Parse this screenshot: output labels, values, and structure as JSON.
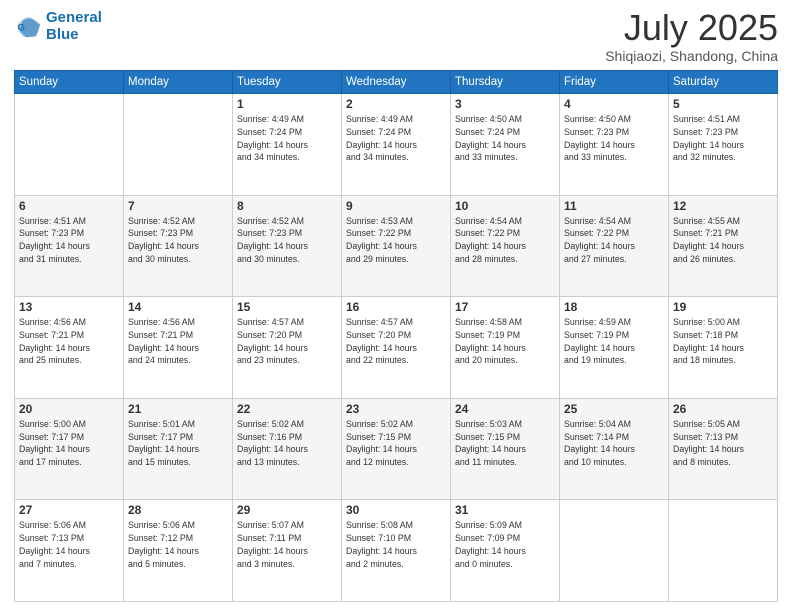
{
  "logo": {
    "line1": "General",
    "line2": "Blue"
  },
  "title": "July 2025",
  "location": "Shiqiaozi, Shandong, China",
  "days_of_week": [
    "Sunday",
    "Monday",
    "Tuesday",
    "Wednesday",
    "Thursday",
    "Friday",
    "Saturday"
  ],
  "weeks": [
    [
      {
        "day": "",
        "info": ""
      },
      {
        "day": "",
        "info": ""
      },
      {
        "day": "1",
        "info": "Sunrise: 4:49 AM\nSunset: 7:24 PM\nDaylight: 14 hours\nand 34 minutes."
      },
      {
        "day": "2",
        "info": "Sunrise: 4:49 AM\nSunset: 7:24 PM\nDaylight: 14 hours\nand 34 minutes."
      },
      {
        "day": "3",
        "info": "Sunrise: 4:50 AM\nSunset: 7:24 PM\nDaylight: 14 hours\nand 33 minutes."
      },
      {
        "day": "4",
        "info": "Sunrise: 4:50 AM\nSunset: 7:23 PM\nDaylight: 14 hours\nand 33 minutes."
      },
      {
        "day": "5",
        "info": "Sunrise: 4:51 AM\nSunset: 7:23 PM\nDaylight: 14 hours\nand 32 minutes."
      }
    ],
    [
      {
        "day": "6",
        "info": "Sunrise: 4:51 AM\nSunset: 7:23 PM\nDaylight: 14 hours\nand 31 minutes."
      },
      {
        "day": "7",
        "info": "Sunrise: 4:52 AM\nSunset: 7:23 PM\nDaylight: 14 hours\nand 30 minutes."
      },
      {
        "day": "8",
        "info": "Sunrise: 4:52 AM\nSunset: 7:23 PM\nDaylight: 14 hours\nand 30 minutes."
      },
      {
        "day": "9",
        "info": "Sunrise: 4:53 AM\nSunset: 7:22 PM\nDaylight: 14 hours\nand 29 minutes."
      },
      {
        "day": "10",
        "info": "Sunrise: 4:54 AM\nSunset: 7:22 PM\nDaylight: 14 hours\nand 28 minutes."
      },
      {
        "day": "11",
        "info": "Sunrise: 4:54 AM\nSunset: 7:22 PM\nDaylight: 14 hours\nand 27 minutes."
      },
      {
        "day": "12",
        "info": "Sunrise: 4:55 AM\nSunset: 7:21 PM\nDaylight: 14 hours\nand 26 minutes."
      }
    ],
    [
      {
        "day": "13",
        "info": "Sunrise: 4:56 AM\nSunset: 7:21 PM\nDaylight: 14 hours\nand 25 minutes."
      },
      {
        "day": "14",
        "info": "Sunrise: 4:56 AM\nSunset: 7:21 PM\nDaylight: 14 hours\nand 24 minutes."
      },
      {
        "day": "15",
        "info": "Sunrise: 4:57 AM\nSunset: 7:20 PM\nDaylight: 14 hours\nand 23 minutes."
      },
      {
        "day": "16",
        "info": "Sunrise: 4:57 AM\nSunset: 7:20 PM\nDaylight: 14 hours\nand 22 minutes."
      },
      {
        "day": "17",
        "info": "Sunrise: 4:58 AM\nSunset: 7:19 PM\nDaylight: 14 hours\nand 20 minutes."
      },
      {
        "day": "18",
        "info": "Sunrise: 4:59 AM\nSunset: 7:19 PM\nDaylight: 14 hours\nand 19 minutes."
      },
      {
        "day": "19",
        "info": "Sunrise: 5:00 AM\nSunset: 7:18 PM\nDaylight: 14 hours\nand 18 minutes."
      }
    ],
    [
      {
        "day": "20",
        "info": "Sunrise: 5:00 AM\nSunset: 7:17 PM\nDaylight: 14 hours\nand 17 minutes."
      },
      {
        "day": "21",
        "info": "Sunrise: 5:01 AM\nSunset: 7:17 PM\nDaylight: 14 hours\nand 15 minutes."
      },
      {
        "day": "22",
        "info": "Sunrise: 5:02 AM\nSunset: 7:16 PM\nDaylight: 14 hours\nand 13 minutes."
      },
      {
        "day": "23",
        "info": "Sunrise: 5:02 AM\nSunset: 7:15 PM\nDaylight: 14 hours\nand 12 minutes."
      },
      {
        "day": "24",
        "info": "Sunrise: 5:03 AM\nSunset: 7:15 PM\nDaylight: 14 hours\nand 11 minutes."
      },
      {
        "day": "25",
        "info": "Sunrise: 5:04 AM\nSunset: 7:14 PM\nDaylight: 14 hours\nand 10 minutes."
      },
      {
        "day": "26",
        "info": "Sunrise: 5:05 AM\nSunset: 7:13 PM\nDaylight: 14 hours\nand 8 minutes."
      }
    ],
    [
      {
        "day": "27",
        "info": "Sunrise: 5:06 AM\nSunset: 7:13 PM\nDaylight: 14 hours\nand 7 minutes."
      },
      {
        "day": "28",
        "info": "Sunrise: 5:06 AM\nSunset: 7:12 PM\nDaylight: 14 hours\nand 5 minutes."
      },
      {
        "day": "29",
        "info": "Sunrise: 5:07 AM\nSunset: 7:11 PM\nDaylight: 14 hours\nand 3 minutes."
      },
      {
        "day": "30",
        "info": "Sunrise: 5:08 AM\nSunset: 7:10 PM\nDaylight: 14 hours\nand 2 minutes."
      },
      {
        "day": "31",
        "info": "Sunrise: 5:09 AM\nSunset: 7:09 PM\nDaylight: 14 hours\nand 0 minutes."
      },
      {
        "day": "",
        "info": ""
      },
      {
        "day": "",
        "info": ""
      }
    ]
  ]
}
